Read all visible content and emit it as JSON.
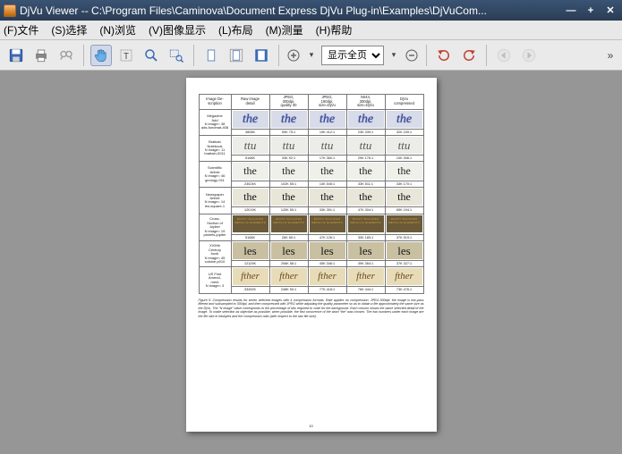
{
  "window": {
    "title": "DjVu Viewer -- C:\\Program Files\\Caminova\\Document Express DjVu Plug-in\\Examples\\DjVuCom..."
  },
  "menus": {
    "file": "(F)文件",
    "select": "(S)选择",
    "browse": "(N)浏览",
    "view": "(V)图像显示",
    "layout": "(L)布局",
    "measure": "(M)测量",
    "help": "(H)帮助"
  },
  "toolbar": {
    "zoom_label": "显示全页"
  },
  "doc": {
    "page_num": "10",
    "headers": {
      "c1": "Image  De-\nscription",
      "c2": "Raw image\ndetail",
      "c3": "JPEG,\n300dpi,\nquality 30",
      "c4": "JPEG,\n150dpi,\nsize=DjVu",
      "c5": "IW44,\n300dpi,\nsize=DjVu",
      "c6": "DjVu\ncompressed"
    },
    "rows": [
      {
        "label": "Megazine\nAdd\nN image= 38\nads-fondmat-408",
        "swatch": "the",
        "class": "sw-the-blue",
        "vals": [
          "3808K",
          "59K 75:1",
          "19K 412:1",
          "23K 339:1",
          "32K 249:1"
        ]
      },
      {
        "label": "Brattain\nNotebook\nN image= 11\nbrattain-0011",
        "swatch": "ttu",
        "class": "sw-ttu",
        "vals": [
          "5168K",
          "33K 92:1",
          "17K 360:1",
          "29K 176:1",
          "10K 306:1"
        ]
      },
      {
        "label": "Scientific\nArticle\nN image= 46\ngeology-011",
        "swatch": "the",
        "class": "sw-the-serif",
        "vals": [
          "23024K",
          "102K 55:1",
          "14K 545:1",
          "33K 511:1",
          "33K 170:1"
        ]
      },
      {
        "label": "Newspaper\nArticle\nN image= 14\nles-square-1",
        "swatch": "the",
        "class": "sw-the-news",
        "vals": [
          "12019K",
          "120K 55:1",
          "33K 391:1",
          "47K 304:1",
          "65K 194:1"
        ]
      },
      {
        "label": "Cross-\nSection of\nJupiter\nN image= 19\nplanets-jupiter",
        "swatch": "ROCKY SILICATES METALLIC ELEMENTS",
        "class": "sw-rocky",
        "vals": [
          "5168K",
          "26K 89:1",
          "47K 126:1",
          "30K 189:1",
          "37K 519:1"
        ]
      },
      {
        "label": "XVIIIth\nCentury\nbook\nN image= 45\ncuisine-p010",
        "swatch": "les",
        "class": "sw-les",
        "vals": [
          "12129K",
          "206K 58:1",
          "45K 346:1",
          "39K 364:1",
          "37K 327:1"
        ]
      },
      {
        "label": "US First\nAmend-\nment\nN image= 3",
        "swatch": "fther",
        "class": "sw-fther",
        "vals": [
          "33492K",
          "248K 90:1",
          "77K 418:1",
          "76K 444:1",
          "73K 476:1"
        ]
      }
    ],
    "caption": "Figure 5: Compression results for seven selected images with 4 compression formats. Rate applies no compression. JPEG-300dpi: the image is low-pass filtered and subsampled to 300dpi, and then compressed with JPEG while adjusting the quality parameter so as to obtain a file approximately the same size as the DjVu.  The “N image” value corresponds to the percentage of bits required to code for the background. Each column shows the same selected detail of the image. To make selection as objective as possible, when possible, the first occurrence of the word “the” was chosen. The two numbers under each image are the file size in kilobytes and the compression ratio (with respect to the raw file size)."
  }
}
